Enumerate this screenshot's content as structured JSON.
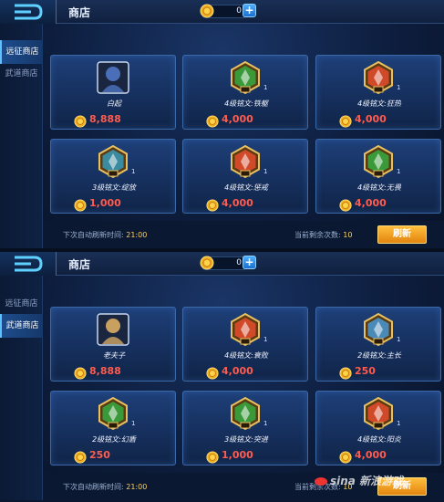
{
  "shops": [
    {
      "title": "商店",
      "coin_count": "0",
      "plus": "+",
      "tabs": [
        "远征商店",
        "武道商店"
      ],
      "active_tab": 0,
      "items": [
        {
          "name": "白起",
          "price": "8,888",
          "type": "hero",
          "color": "#4a6fb8",
          "level": ""
        },
        {
          "name": "4级铭文:铁躯",
          "price": "4,000",
          "type": "rune",
          "color": "#3a9a3a",
          "level": "1"
        },
        {
          "name": "4级铭文:狂热",
          "price": "4,000",
          "type": "rune",
          "color": "#d04a2a",
          "level": "1"
        },
        {
          "name": "3级铭文:绽放",
          "price": "1,000",
          "type": "rune",
          "color": "#3a8aa0",
          "level": "1"
        },
        {
          "name": "4级铭文:惩戒",
          "price": "4,000",
          "type": "rune",
          "color": "#d04a2a",
          "level": "1"
        },
        {
          "name": "4级铭文:无畏",
          "price": "4,000",
          "type": "rune",
          "color": "#3a9a3a",
          "level": "1"
        }
      ],
      "refresh_label": "下次自动刷新时间:",
      "refresh_time": "21:00",
      "remain_label": "当前剩余次数:",
      "remain_count": "10",
      "refresh_button": "刷新"
    },
    {
      "title": "商店",
      "coin_count": "0",
      "plus": "+",
      "tabs": [
        "远征商店",
        "武道商店"
      ],
      "active_tab": 1,
      "items": [
        {
          "name": "老夫子",
          "price": "8,888",
          "type": "hero",
          "color": "#c8a060",
          "level": ""
        },
        {
          "name": "4级铭文:衰败",
          "price": "4,000",
          "type": "rune",
          "color": "#d04a2a",
          "level": "1"
        },
        {
          "name": "2级铭文:主长",
          "price": "250",
          "type": "rune",
          "color": "#4a8ab8",
          "level": "1"
        },
        {
          "name": "2级铭文:幻盾",
          "price": "250",
          "type": "rune",
          "color": "#3a9a3a",
          "level": "1"
        },
        {
          "name": "3级铭文:突进",
          "price": "1,000",
          "type": "rune",
          "color": "#3a9a3a",
          "level": "1"
        },
        {
          "name": "4级铭文:阳炎",
          "price": "4,000",
          "type": "rune",
          "color": "#d04a2a",
          "level": "1"
        }
      ],
      "refresh_label": "下次自动刷新时间:",
      "refresh_time": "21:00",
      "remain_label": "当前剩余次数:",
      "remain_count": "10",
      "refresh_button": "刷新"
    }
  ],
  "watermark": "sina 新浪游戏"
}
